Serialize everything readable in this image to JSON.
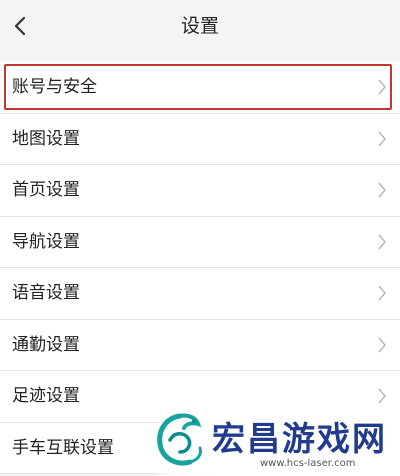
{
  "header": {
    "title": "设置",
    "back_icon": "chevron-left-icon"
  },
  "settings": {
    "items": [
      {
        "label": "账号与安全",
        "highlighted": true
      },
      {
        "label": "地图设置"
      },
      {
        "label": "首页设置"
      },
      {
        "label": "导航设置"
      },
      {
        "label": "语音设置"
      },
      {
        "label": "通勤设置"
      },
      {
        "label": "足迹设置"
      },
      {
        "label": "手车互联设置"
      }
    ],
    "chevron_icon": "chevron-right-icon"
  },
  "watermark": {
    "brand": "宏昌游戏网",
    "url": "www.hcs-laser.com"
  },
  "colors": {
    "background": "#f4f4f4",
    "row_background": "#ffffff",
    "highlight_border": "#c0392b",
    "watermark_text": "#213c8f",
    "watermark_logo": "#17a3a0"
  }
}
